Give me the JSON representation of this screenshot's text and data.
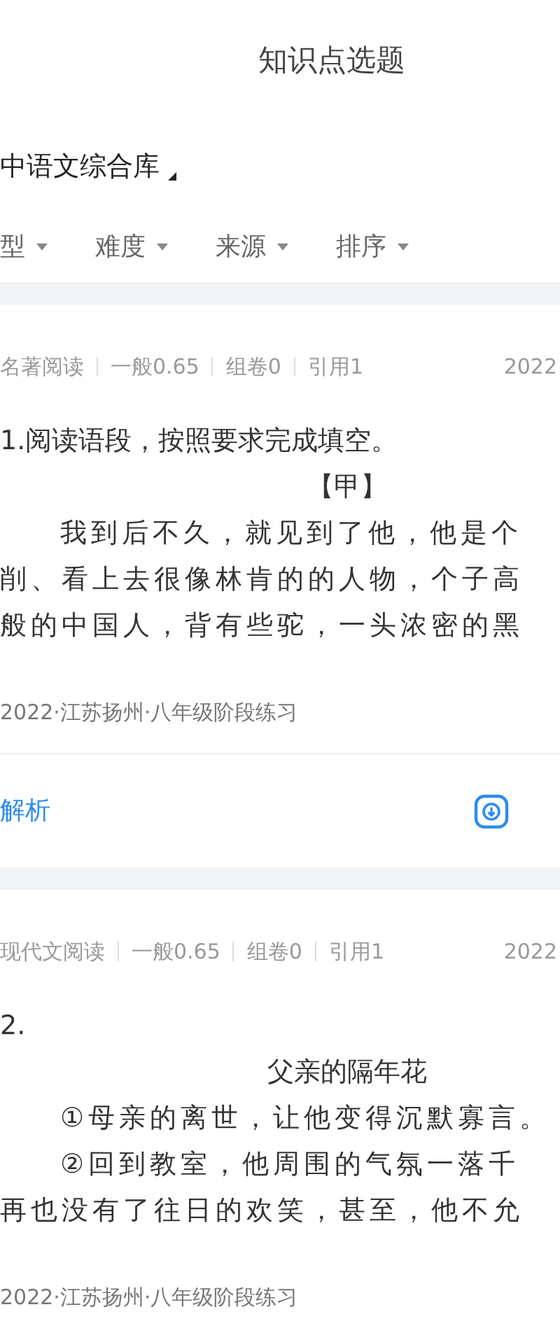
{
  "header": {
    "title": "知识点选题"
  },
  "library": {
    "label": "中语文综合库"
  },
  "filters": [
    {
      "label": "型"
    },
    {
      "label": "难度"
    },
    {
      "label": "来源"
    },
    {
      "label": "排序"
    }
  ],
  "questions": [
    {
      "meta": [
        "名著阅读",
        "一般0.65",
        "组卷0",
        "引用1"
      ],
      "date": "2022",
      "stem": "1.阅读语段，按照要求完成填空。",
      "heading": "【甲】",
      "lines": [
        {
          "kind": "indent",
          "text": "我到后不久，就见到了他，他是个"
        },
        {
          "kind": "plain",
          "text": "削、看上去很像林肯的的人物，个子高"
        },
        {
          "kind": "plain",
          "text": "般的中国人，背有些驼，一头浓密的黑"
        }
      ],
      "source": "2022·江苏扬州·八年级阶段练习",
      "analysis": "解析"
    },
    {
      "meta": [
        "现代文阅读",
        "一般0.65",
        "组卷0",
        "引用1"
      ],
      "date": "2022",
      "stem": "2.",
      "heading": "父亲的隔年花",
      "lines": [
        {
          "kind": "indent",
          "text": "①母亲的离世，让他变得沉默寡言。"
        },
        {
          "kind": "indent",
          "text": "②回到教室，他周围的气氛一落千"
        },
        {
          "kind": "plain",
          "text": "再也没有了往日的欢笑，甚至，他不允"
        }
      ],
      "source": "2022·江苏扬州·八年级阶段练习"
    }
  ]
}
